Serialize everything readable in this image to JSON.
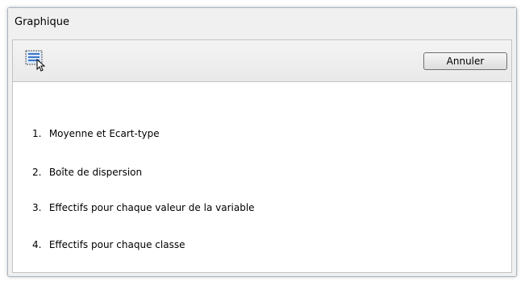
{
  "window": {
    "title": "Graphique"
  },
  "toolbar": {
    "select_icon": "selection-cursor-icon",
    "cancel_label": "Annuler"
  },
  "options": [
    {
      "number": "1.",
      "label": "Moyenne et Ecart-type"
    },
    {
      "number": "2.",
      "label": "Boîte de dispersion"
    },
    {
      "number": "3.",
      "label": "Effectifs pour chaque valeur de la variable"
    },
    {
      "number": "4.",
      "label": "Effectifs pour chaque classe"
    }
  ],
  "colors": {
    "window_bg": "#f0f0f0",
    "content_bg": "#ffffff",
    "border": "#c3c3c3",
    "icon_accent": "#3b78c8"
  }
}
